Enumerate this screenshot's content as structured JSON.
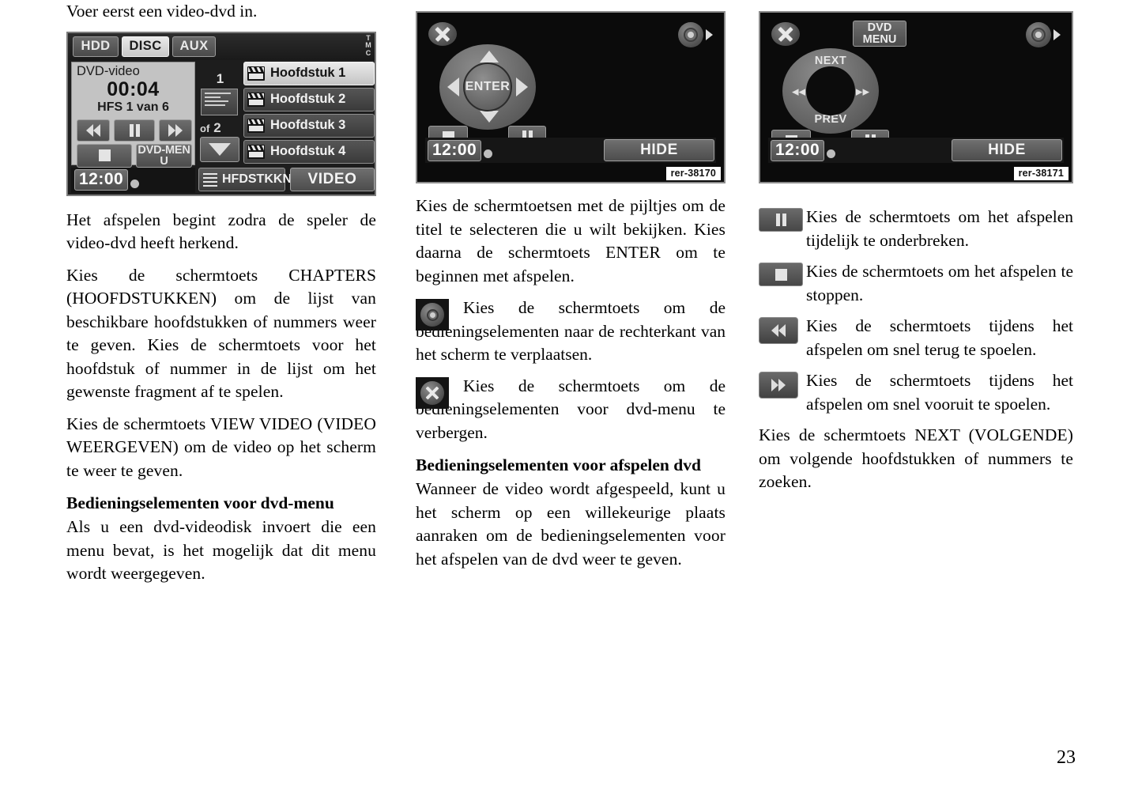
{
  "page": {
    "number": "23"
  },
  "left_column": {
    "intro": "Voer eerst een video-dvd in.",
    "screen": {
      "tabs": [
        {
          "label": "HDD",
          "selected": false
        },
        {
          "label": "DISC",
          "selected": true
        },
        {
          "label": "AUX",
          "selected": false
        }
      ],
      "tmc_indicator": "TMC",
      "source_label": "DVD-video",
      "elapsed_time": "00:04",
      "track_status": "HFS 1 van 6",
      "transport": {
        "rewind": "rewind-icon",
        "pause": "pause-icon",
        "fast_forward": "fast-forward-icon",
        "stop": "stop-icon",
        "dvd_menu_line1": "DVD-MEN",
        "dvd_menu_line2": "U"
      },
      "clock": "12:00",
      "pager": {
        "current": "1",
        "of_label": "of",
        "total": "2"
      },
      "chapters": [
        {
          "label": "Hoofdstuk 1",
          "selected": true
        },
        {
          "label": "Hoofdstuk 2",
          "selected": false
        },
        {
          "label": "Hoofdstuk 3",
          "selected": false
        },
        {
          "label": "Hoofdstuk 4",
          "selected": false
        }
      ],
      "chapters_button": "HFDSTKKN",
      "video_button": "VIDEO"
    },
    "paragraphs": [
      "Het afspelen begint zodra de speler de video-dvd heeft herkend.",
      "Kies de schermtoets CHAPTERS (HOOFDSTUKKEN) om de lijst van beschikbare hoofdstukken of nummers weer te geven. Kies de schermtoets voor het hoofdstuk of nummer in de lijst om het gewenste fragment af te spelen.",
      "Kies de schermtoets VIEW VIDEO (VIDEO WEERGEVEN) om de video op het scherm te weer te geven."
    ],
    "heading": "Bedieningselementen voor dvd-menu",
    "heading_body": "Als u een dvd-videodisk invoert die een menu bevat, is het mogelijk dat dit menu wordt weergegeven."
  },
  "middle_column": {
    "screen": {
      "close_button": "close-icon",
      "move_button": "move-controls-icon",
      "dpad": {
        "up": "up-arrow-icon",
        "down": "down-arrow-icon",
        "left": "left-arrow-icon",
        "right": "right-arrow-icon",
        "center": "ENTER"
      },
      "stop": "stop-icon",
      "pause": "pause-icon",
      "clock": "12:00",
      "hide_button": "HIDE",
      "reference": "rer-38170"
    },
    "paragraphs": [
      "Kies de schermtoetsen met de pijltjes om de titel te selecteren die u wilt bekijken. Kies daarna de schermtoets ENTER om te beginnen met afspelen."
    ],
    "bullets": [
      {
        "icon": "move-controls-icon",
        "text": "Kies de schermtoets om de bedieningselementen naar de rechterkant van het scherm te verplaatsen."
      },
      {
        "icon": "close-icon",
        "text": "Kies de schermtoets om de bedieningselementen voor dvd-menu te verbergen."
      }
    ],
    "heading": "Bedieningselementen voor afspelen dvd",
    "heading_body": "Wanneer de video wordt afgespeeld, kunt u het scherm op een willekeurige plaats aanraken om de bedieningselementen voor het afspelen van de dvd weer te geven."
  },
  "right_column": {
    "screen": {
      "close_button": "close-icon",
      "dvd_menu_line1": "DVD",
      "dvd_menu_line2": "MENU",
      "move_button": "move-controls-icon",
      "dpad": {
        "top": "NEXT",
        "bottom": "PREV",
        "left": "rewind-icon",
        "right": "fast-forward-icon"
      },
      "stop": "stop-icon",
      "pause": "pause-icon",
      "clock": "12:00",
      "hide_button": "HIDE",
      "reference": "rer-38171"
    },
    "bullets": [
      {
        "icon": "pause-icon",
        "text": "Kies de schermtoets om het afspelen tijdelijk te onderbreken."
      },
      {
        "icon": "stop-icon",
        "text": "Kies de schermtoets om het afspelen te stoppen."
      },
      {
        "icon": "rewind-icon",
        "text": "Kies de schermtoets tijdens het afspelen om snel terug te spoelen."
      },
      {
        "icon": "fast-forward-icon",
        "text": "Kies de schermtoets tijdens het afspelen om snel vooruit te spoelen."
      }
    ],
    "closing_paragraph": "Kies de schermtoets NEXT (VOLGENDE) om volgende hoofdstukken of nummers te zoeken."
  }
}
